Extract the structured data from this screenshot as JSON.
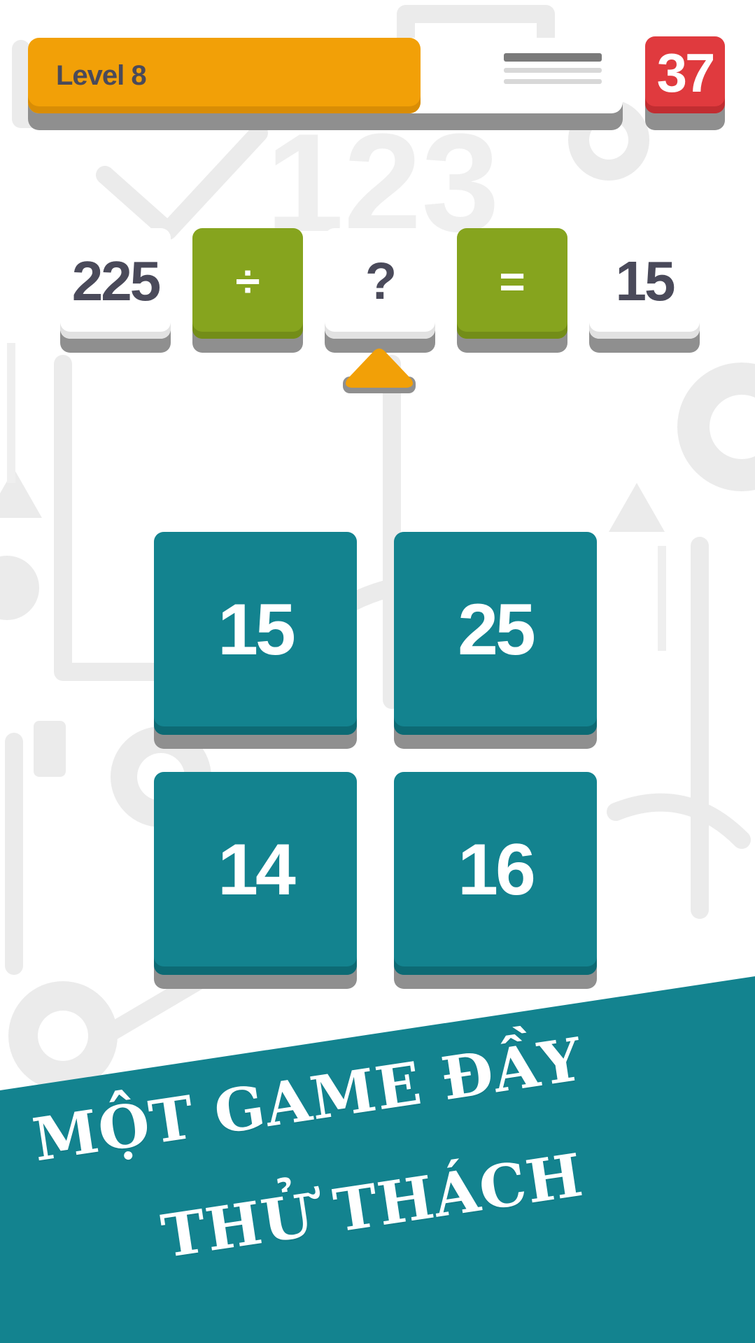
{
  "header": {
    "level_label": "Level 8",
    "level_progress": 0.66,
    "timer": "37"
  },
  "equation": {
    "operand_left": "225",
    "operator": "÷",
    "unknown": "?",
    "equals": "=",
    "result": "15"
  },
  "answers": [
    {
      "label": "15"
    },
    {
      "label": "25"
    },
    {
      "label": "14"
    },
    {
      "label": "16"
    }
  ],
  "banner": {
    "line1": "MỘT GAME ĐẦY",
    "line2": "THỬ THÁCH"
  },
  "colors": {
    "orange": "#f2a007",
    "red": "#e03a3e",
    "green": "#86a41e",
    "teal": "#13838f",
    "text_dark": "#4a4a5a",
    "background_icons": "#ebebeb"
  }
}
